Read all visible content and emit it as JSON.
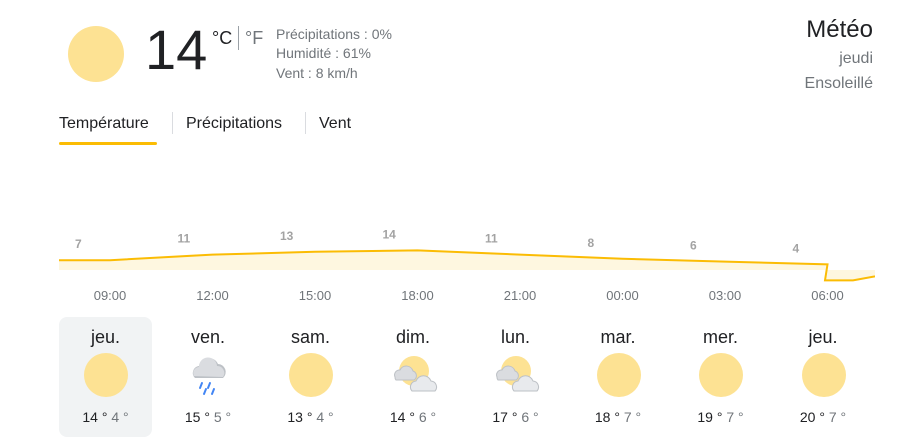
{
  "current": {
    "temp": "14",
    "unit_c": "°C",
    "unit_f": "°F",
    "precipitation": "Précipitations : 0%",
    "humidity": "Humidité : 61%",
    "wind": "Vent : 8 km/h",
    "icon": "sun-icon"
  },
  "header": {
    "title": "Météo",
    "day": "jeudi",
    "condition": "Ensoleillé"
  },
  "tabs": [
    {
      "label": "Température",
      "active": true
    },
    {
      "label": "Précipitations",
      "active": false
    },
    {
      "label": "Vent",
      "active": false
    }
  ],
  "colors": {
    "accent": "#fbbc04",
    "chart_fill": "#fef7e0",
    "sun": "#fde293"
  },
  "chart_data": {
    "type": "area",
    "x": [
      "09:00",
      "12:00",
      "15:00",
      "18:00",
      "21:00",
      "00:00",
      "03:00",
      "06:00"
    ],
    "values": [
      7,
      11,
      13,
      14,
      11,
      8,
      6,
      4
    ],
    "title": "",
    "xlabel": "",
    "ylabel": ""
  },
  "days": [
    {
      "name": "jeu.",
      "high": "14 °",
      "low": "4 °",
      "icon": "sun-icon",
      "selected": true
    },
    {
      "name": "ven.",
      "high": "15 °",
      "low": "5 °",
      "icon": "rain-cloud-icon",
      "selected": false
    },
    {
      "name": "sam.",
      "high": "13 °",
      "low": "4 °",
      "icon": "sun-icon",
      "selected": false
    },
    {
      "name": "dim.",
      "high": "14 °",
      "low": "6 °",
      "icon": "partly-cloudy-icon",
      "selected": false
    },
    {
      "name": "lun.",
      "high": "17 °",
      "low": "6 °",
      "icon": "partly-cloudy-icon",
      "selected": false
    },
    {
      "name": "mar.",
      "high": "18 °",
      "low": "7 °",
      "icon": "sun-icon",
      "selected": false
    },
    {
      "name": "mer.",
      "high": "19 °",
      "low": "7 °",
      "icon": "sun-icon",
      "selected": false
    },
    {
      "name": "jeu.",
      "high": "20 °",
      "low": "7 °",
      "icon": "sun-icon",
      "selected": false
    }
  ]
}
